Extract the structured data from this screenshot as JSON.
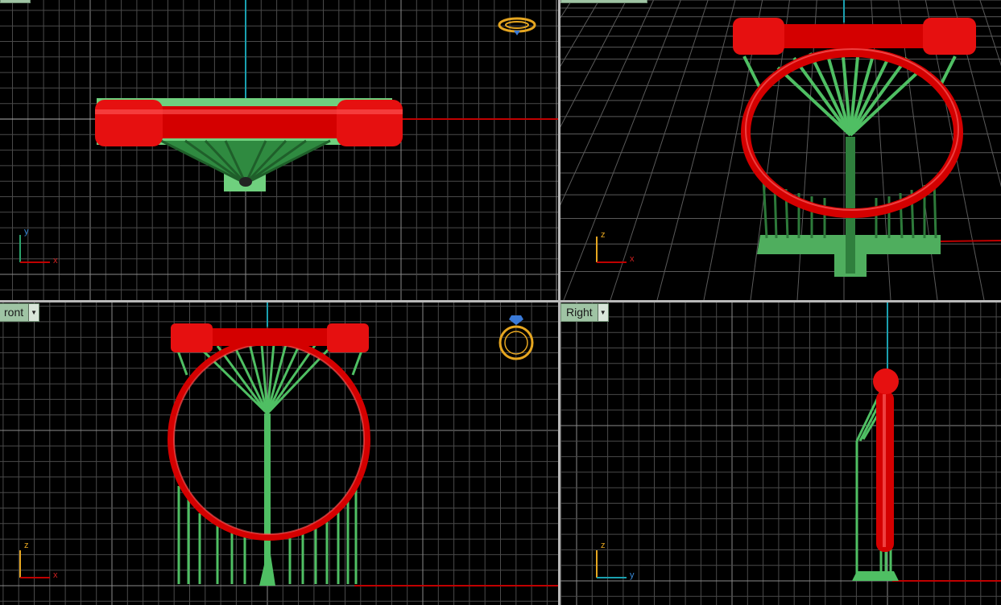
{
  "viewports": {
    "top": {
      "label": ""
    },
    "perspective": {
      "label": ""
    },
    "front": {
      "label": "ront"
    },
    "right": {
      "label": "Right"
    }
  },
  "axes": {
    "top": {
      "h": "x",
      "v": "y"
    },
    "perspective": {
      "h": "x",
      "v": "z"
    },
    "front": {
      "h": "x",
      "v": "z"
    },
    "right": {
      "h": "y",
      "v": "z"
    }
  },
  "colors": {
    "background": "#000000",
    "grid": "#5a5a5a",
    "grid_major": "#8a8a8a",
    "model_bar": "#e10000",
    "supports": "#58c06a",
    "x_axis": "#c00000",
    "y_axis": "#2aa36b",
    "z_axis": "#1aa0b0",
    "tab_bg": "#9fc4a4",
    "ring_icon": "#e6a620"
  }
}
